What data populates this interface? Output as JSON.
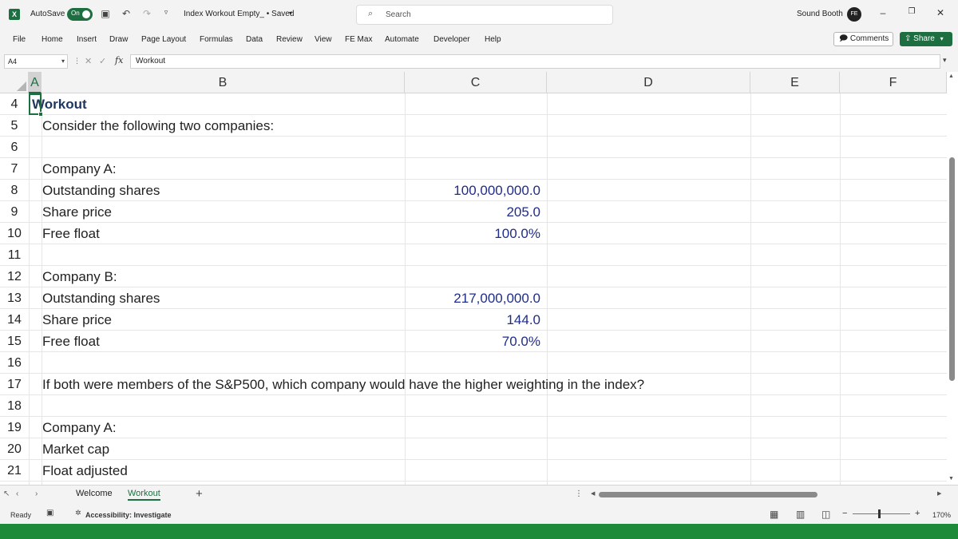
{
  "titlebar": {
    "logo": "X",
    "autosave_label": "AutoSave",
    "autosave_state": "On",
    "filename": "Index Workout Empty_ • Saved",
    "search_placeholder": "Search",
    "user_name": "Sound Booth",
    "avatar_initials": "FE"
  },
  "ribbon": {
    "tabs": [
      "File",
      "Home",
      "Insert",
      "Draw",
      "Page Layout",
      "Formulas",
      "Data",
      "Review",
      "View",
      "FE Max",
      "Automate",
      "Developer",
      "Help"
    ],
    "comments_label": "Comments",
    "share_label": "Share"
  },
  "formula_bar": {
    "name_box": "A4",
    "fx": "fx",
    "content": "Workout"
  },
  "grid": {
    "columns": [
      "A",
      "B",
      "C",
      "D",
      "E",
      "F"
    ],
    "rows": [
      "4",
      "5",
      "6",
      "7",
      "8",
      "9",
      "10",
      "11",
      "12",
      "13",
      "14",
      "15",
      "16",
      "17",
      "18",
      "19",
      "20",
      "21"
    ],
    "cells": {
      "A4": "Workout",
      "B5": "Consider the following two companies:",
      "B7": "Company A:",
      "B8": "Outstanding shares",
      "C8": "100,000,000.0",
      "B9": "Share price",
      "C9": "205.0",
      "B10": "Free float",
      "C10": "100.0%",
      "B12": "Company B:",
      "B13": "Outstanding shares",
      "C13": "217,000,000.0",
      "B14": "Share price",
      "C14": "144.0",
      "B15": "Free float",
      "C15": "70.0%",
      "B17": "If both were members of the S&P500, which company would have the higher weighting in the index?",
      "B19": "Company A:",
      "B20": "Market cap",
      "B21": "Float adjusted"
    }
  },
  "sheets": {
    "tabs": [
      "Welcome",
      "Workout"
    ],
    "active": "Workout"
  },
  "statusbar": {
    "ready": "Ready",
    "accessibility": "Accessibility: Investigate",
    "zoom": "170%"
  },
  "colors": {
    "excel_green": "#1d6f42",
    "number_blue": "#1f2d8a",
    "title_navy": "#1f3760"
  }
}
